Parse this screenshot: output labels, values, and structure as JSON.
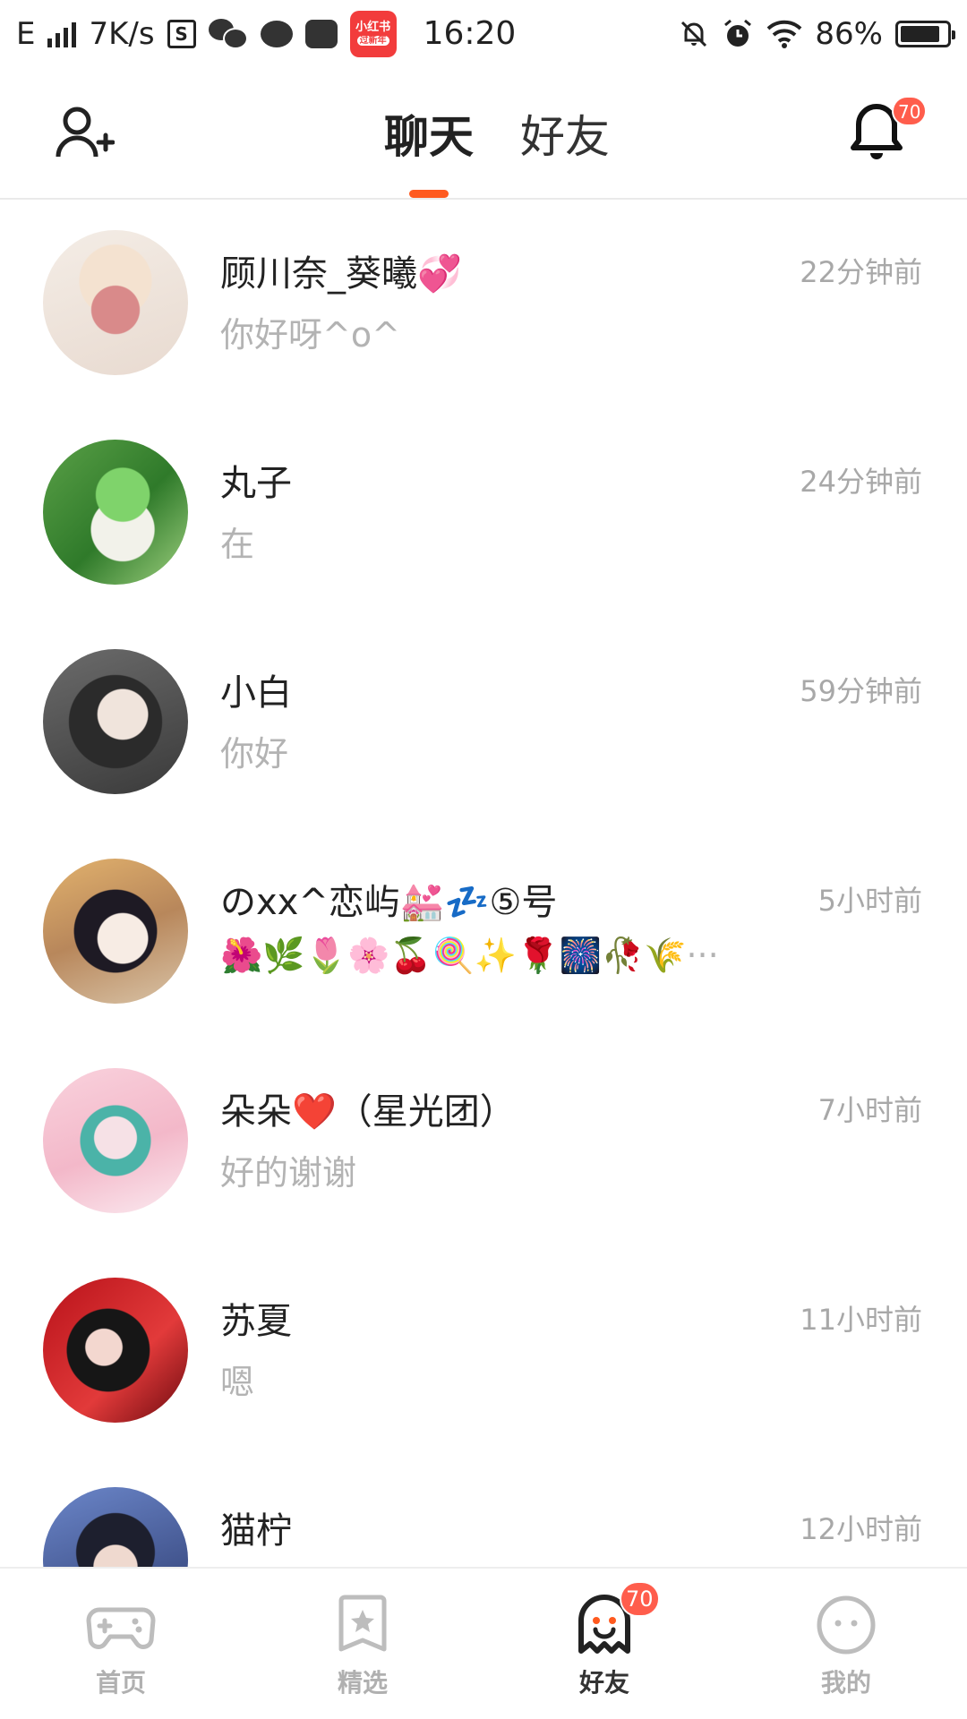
{
  "status_bar": {
    "network": "E",
    "speed": "7K/s",
    "time": "16:20",
    "battery": "86%",
    "xhs_top": "小红书",
    "xhs_bottom": "过新年"
  },
  "header": {
    "tabs": [
      {
        "label": "聊天",
        "active": true
      },
      {
        "label": "好友",
        "active": false
      }
    ],
    "notification_count": "70",
    "accent_color": "#ff5a1f"
  },
  "chats": [
    {
      "name": "顾川奈_葵曦💞",
      "time": "22分钟前",
      "message": "你好呀^o^"
    },
    {
      "name": "丸子",
      "time": "24分钟前",
      "message": "在"
    },
    {
      "name": "小白",
      "time": "59分钟前",
      "message": "你好"
    },
    {
      "name": "のxx^恋屿💒💤⑤号",
      "time": "5小时前",
      "message": "🌺🌿🌷🌸🍒🍭✨🌹🎆🥀🌾···"
    },
    {
      "name": "朵朵❤️（星光团）",
      "time": "7小时前",
      "message": "好的谢谢"
    },
    {
      "name": "苏夏",
      "time": "11小时前",
      "message": "嗯"
    },
    {
      "name": "猫柠",
      "time": "12小时前",
      "message": ""
    }
  ],
  "bottom_nav": [
    {
      "label": "首页",
      "icon": "gamepad-icon",
      "active": false
    },
    {
      "label": "精选",
      "icon": "star-bookmark-icon",
      "active": false
    },
    {
      "label": "好友",
      "icon": "ghost-icon",
      "active": true,
      "badge": "70"
    },
    {
      "label": "我的",
      "icon": "face-icon",
      "active": false
    }
  ]
}
